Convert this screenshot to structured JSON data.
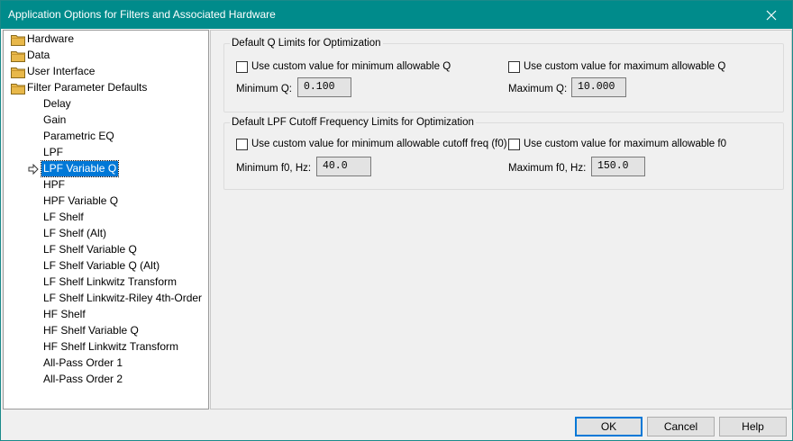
{
  "window": {
    "title": "Application Options for Filters and Associated Hardware"
  },
  "tree": {
    "items": [
      {
        "label": "Hardware",
        "level": 0,
        "folder": true
      },
      {
        "label": "Data",
        "level": 0,
        "folder": true
      },
      {
        "label": "User Interface",
        "level": 0,
        "folder": true
      },
      {
        "label": "Filter Parameter Defaults",
        "level": 0,
        "folder": true
      },
      {
        "label": "Delay",
        "level": 1
      },
      {
        "label": "Gain",
        "level": 1
      },
      {
        "label": "Parametric EQ",
        "level": 1
      },
      {
        "label": "LPF",
        "level": 1
      },
      {
        "label": "LPF Variable Q",
        "level": 1,
        "selected": true
      },
      {
        "label": "HPF",
        "level": 1
      },
      {
        "label": "HPF Variable Q",
        "level": 1
      },
      {
        "label": "LF Shelf",
        "level": 1
      },
      {
        "label": "LF Shelf (Alt)",
        "level": 1
      },
      {
        "label": "LF Shelf Variable Q",
        "level": 1
      },
      {
        "label": "LF Shelf Variable Q (Alt)",
        "level": 1
      },
      {
        "label": "LF Shelf Linkwitz Transform",
        "level": 1
      },
      {
        "label": "LF Shelf Linkwitz-Riley 4th-Order",
        "level": 1
      },
      {
        "label": "HF Shelf",
        "level": 1
      },
      {
        "label": "HF Shelf Variable Q",
        "level": 1
      },
      {
        "label": "HF Shelf Linkwitz Transform",
        "level": 1
      },
      {
        "label": "All-Pass Order 1",
        "level": 1
      },
      {
        "label": "All-Pass Order 2",
        "level": 1
      }
    ]
  },
  "q_limits": {
    "title": "Default Q Limits for Optimization",
    "min_check_label": "Use custom value for minimum allowable Q",
    "max_check_label": "Use custom value for maximum allowable Q",
    "min_label": "Minimum Q:",
    "min_value": "0.100",
    "max_label": "Maximum Q:",
    "max_value": "10.000"
  },
  "cutoff_limits": {
    "title": "Default LPF Cutoff Frequency Limits for Optimization",
    "min_check_label": "Use custom value for minimum allowable cutoff freq (f0)",
    "max_check_label": "Use custom value for maximum allowable f0",
    "min_label": "Minimum f0, Hz:",
    "min_value": "40.0",
    "max_label": "Maximum f0, Hz:",
    "max_value": "150.0"
  },
  "buttons": {
    "ok": "OK",
    "cancel": "Cancel",
    "help": "Help"
  },
  "colors": {
    "titlebar": "#008b8b",
    "selection": "#0078d7",
    "folder": "#e8b84a"
  }
}
